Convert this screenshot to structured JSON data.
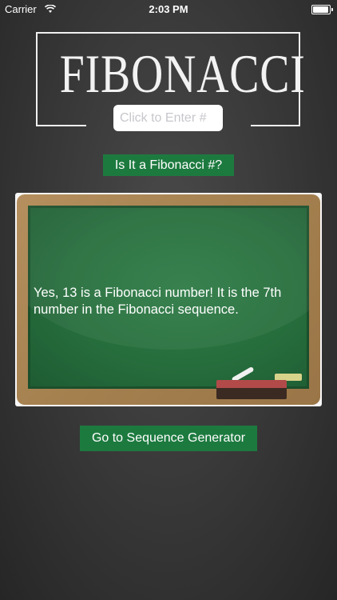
{
  "status_bar": {
    "carrier": "Carrier",
    "time": "2:03 PM",
    "wifi_icon": "wifi-icon",
    "battery_icon": "battery-icon"
  },
  "header": {
    "title": "FIBONACCI"
  },
  "entry": {
    "placeholder": "Click to Enter #",
    "value": ""
  },
  "check_button": {
    "label": "Is It a Fibonacci #?"
  },
  "chalkboard": {
    "message": "Yes, 13 is a Fibonacci number! It is the 7th number in the Fibonacci sequence."
  },
  "sequence_button": {
    "label": "Go to Sequence Generator"
  },
  "colors": {
    "button_green": "#1d7a3f",
    "background": "#3a3a3a",
    "board_green": "#2e7c46",
    "board_frame": "#a4804f"
  }
}
